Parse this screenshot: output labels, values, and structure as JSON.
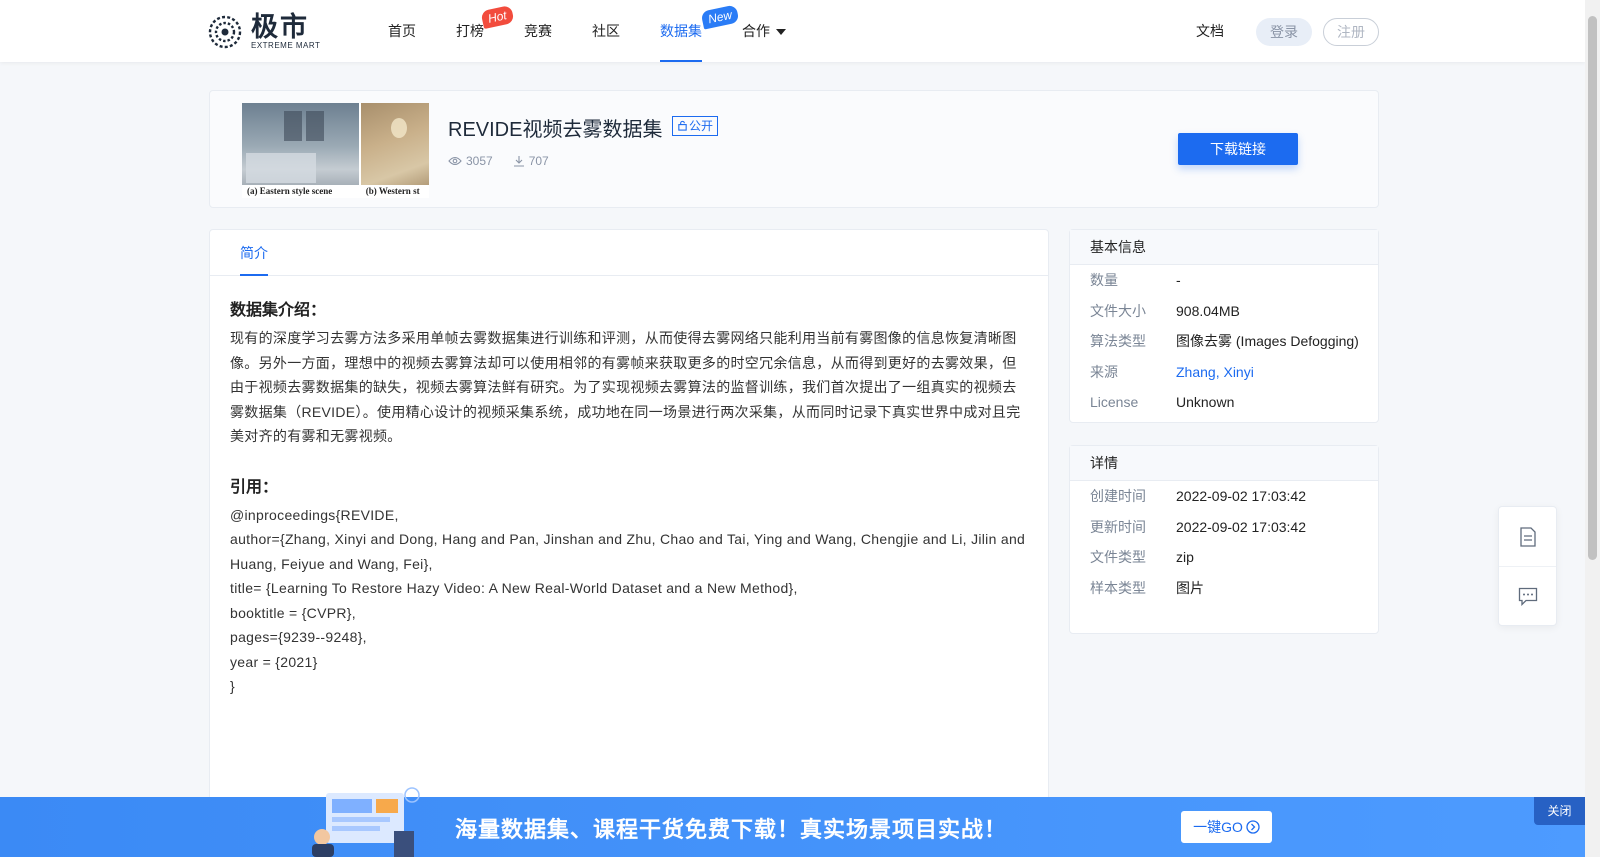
{
  "nav": {
    "logo_cn": "极市",
    "logo_en": "EXTREME MART",
    "items": [
      {
        "label": "首页",
        "badge": ""
      },
      {
        "label": "打榜",
        "badge": "Hot"
      },
      {
        "label": "竞赛",
        "badge": ""
      },
      {
        "label": "社区",
        "badge": ""
      },
      {
        "label": "数据集",
        "badge": "New"
      },
      {
        "label": "合作",
        "badge": ""
      }
    ],
    "docs": "文档",
    "login": "登录",
    "register": "注册"
  },
  "dataset": {
    "title": "REVIDE视频去雾数据集",
    "visibility": "公开",
    "views": "3057",
    "downloads": "707",
    "download_button": "下载链接",
    "thumb_caption_a": "(a) Eastern style scene",
    "thumb_caption_b": "(b) Western st"
  },
  "tabs": {
    "intro": "简介"
  },
  "intro": {
    "heading": "数据集介绍：",
    "body": "现有的深度学习去雾方法多采用单帧去雾数据集进行训练和评测，从而使得去雾网络只能利用当前有雾图像的信息恢复清晰图像。另外一方面，理想中的视频去雾算法却可以使用相邻的有雾帧来获取更多的时空冗余信息，从而得到更好的去雾效果，但由于视频去雾数据集的缺失，视频去雾算法鲜有研究。为了实现视频去雾算法的监督训练，我们首次提出了一组真实的视频去雾数据集（REVIDE）。使用精心设计的视频采集系统，成功地在同一场景进行两次采集，从而同时记录下真实世界中成对且完美对齐的有雾和无雾视频。",
    "cite_heading": "引用：",
    "cite_lines": [
      "@inproceedings{REVIDE,",
      "author={Zhang, Xinyi and Dong, Hang and Pan, Jinshan and Zhu, Chao and Tai, Ying and Wang, Chengjie and Li, Jilin and Huang, Feiyue and Wang, Fei},",
      "title= {Learning To Restore Hazy Video: A New Real-World Dataset and a New Method},",
      "booktitle = {CVPR},",
      "pages={9239--9248},",
      "year = {2021}",
      "}"
    ]
  },
  "basic_info": {
    "heading": "基本信息",
    "rows": [
      {
        "key": "数量",
        "value": "-"
      },
      {
        "key": "文件大小",
        "value": "908.04MB"
      },
      {
        "key": "算法类型",
        "value": "图像去雾 (Images Defogging)"
      },
      {
        "key": "来源",
        "value": "Zhang, Xinyi"
      },
      {
        "key": "License",
        "value": "Unknown"
      }
    ]
  },
  "details": {
    "heading": "详情",
    "rows": [
      {
        "key": "创建时间",
        "value": "2022-09-02 17:03:42"
      },
      {
        "key": "更新时间",
        "value": "2022-09-02 17:03:42"
      },
      {
        "key": "文件类型",
        "value": "zip"
      },
      {
        "key": "样本类型",
        "value": "图片"
      }
    ]
  },
  "banner": {
    "title": "海量数据集、课程干货免费下载！真实场景项目实战！",
    "button": "一键GO",
    "close": "关闭"
  },
  "colors": {
    "accent": "#1c6bf0",
    "hot": "#f24c3d",
    "banner": "#4d9bff"
  }
}
